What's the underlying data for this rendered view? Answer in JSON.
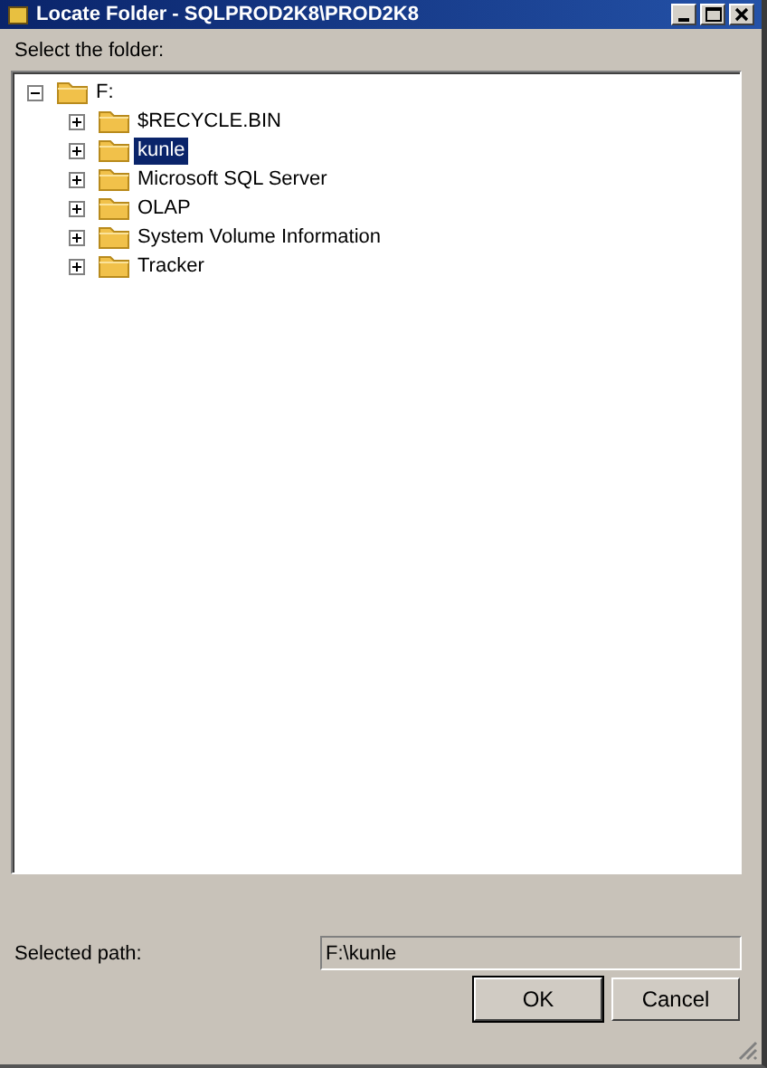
{
  "window": {
    "title": "Locate Folder - SQLPROD2K8\\PROD2K8"
  },
  "prompt": "Select the folder:",
  "tree": [
    {
      "label": "F:",
      "expanded": true,
      "selected": false,
      "children": [
        {
          "label": "$RECYCLE.BIN",
          "expanded": false,
          "selected": false
        },
        {
          "label": "kunle",
          "expanded": false,
          "selected": true
        },
        {
          "label": "Microsoft SQL Server",
          "expanded": false,
          "selected": false
        },
        {
          "label": "OLAP",
          "expanded": false,
          "selected": false
        },
        {
          "label": "System Volume Information",
          "expanded": false,
          "selected": false
        },
        {
          "label": "Tracker",
          "expanded": false,
          "selected": false
        }
      ]
    }
  ],
  "selected_path": {
    "label": "Selected path:",
    "value": "F:\\kunle"
  },
  "buttons": [
    "OK",
    "Cancel"
  ]
}
